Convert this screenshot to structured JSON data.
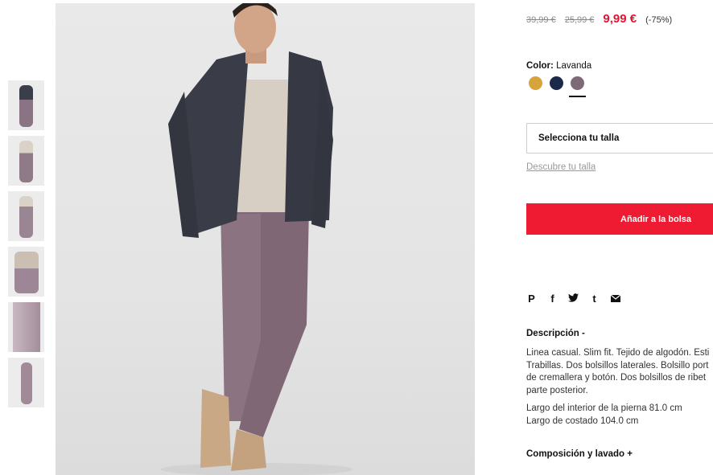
{
  "thumbnails": [
    {
      "name": "thumbnail-look-full"
    },
    {
      "name": "thumbnail-front"
    },
    {
      "name": "thumbnail-front-close"
    },
    {
      "name": "thumbnail-side-detail"
    },
    {
      "name": "thumbnail-fabric-detail"
    },
    {
      "name": "thumbnail-flat-product"
    }
  ],
  "price": {
    "original": "39,99 €",
    "previous": "25,99 €",
    "current": "9,99 €",
    "discount": "(-75%)",
    "accent_color": "#e8102b"
  },
  "color": {
    "label": "Color:",
    "selected": "Lavanda",
    "swatches": [
      {
        "name": "mostaza",
        "hex": "#d9a33c"
      },
      {
        "name": "navy",
        "hex": "#1b2a4a"
      },
      {
        "name": "lavanda",
        "hex": "#7d6a76"
      }
    ]
  },
  "size": {
    "select_label": "Selecciona tu talla",
    "guide_link": "Descubre tu talla"
  },
  "cart": {
    "add_label": "Añadir a la bolsa",
    "button_color": "#ee1b33"
  },
  "share": {
    "icons": [
      "pinterest-icon",
      "facebook-icon",
      "twitter-icon",
      "tumblr-icon",
      "email-icon"
    ],
    "glyphs": [
      "𝓅",
      "f",
      "🐦",
      "t",
      "✉"
    ]
  },
  "description": {
    "title": "Descripción -",
    "lines": [
      "Linea casual. Slim fit. Tejido de algodón. Esti",
      "Trabillas. Dos bolsillos laterales. Bolsillo port",
      "de cremallera y botón. Dos bolsillos de ribet",
      "parte posterior."
    ],
    "measures": [
      "Largo del interior de la pierna 81.0 cm",
      "Largo de costado 104.0 cm"
    ]
  },
  "composition": {
    "title": "Composición y lavado +"
  }
}
